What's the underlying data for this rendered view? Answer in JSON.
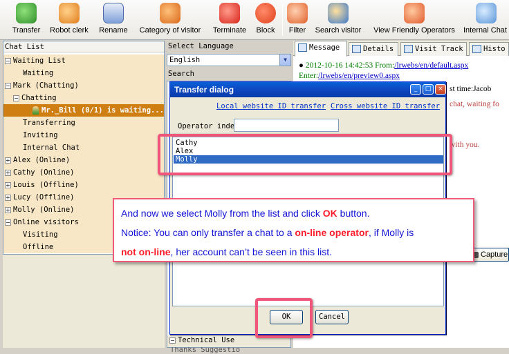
{
  "toolbar": {
    "items": [
      {
        "label": "Transfer",
        "icon": "transfer-icon"
      },
      {
        "label": "Robot clerk",
        "icon": "robot-icon"
      },
      {
        "label": "Rename",
        "icon": "rename-icon"
      },
      {
        "label": "Category of visitor",
        "icon": "category-icon"
      },
      {
        "label": "Terminate",
        "icon": "terminate-icon"
      },
      {
        "label": "Block",
        "icon": "block-icon"
      },
      {
        "label": "Filter",
        "icon": "filter-icon"
      },
      {
        "label": "Search visitor",
        "icon": "search-visitor-icon"
      },
      {
        "label": "View Friendly Operators",
        "icon": "friendly-operators-icon"
      },
      {
        "label": "Internal Chat",
        "icon": "internal-chat-icon"
      }
    ]
  },
  "chat_list": {
    "title": "Chat List",
    "items": [
      {
        "label": "Waiting List",
        "toggle": "−"
      },
      {
        "label": "Waiting"
      },
      {
        "label": "Mark (Chatting)",
        "toggle": "−"
      },
      {
        "label": "Chatting",
        "toggle": "−"
      },
      {
        "label": "Mr._Bill (0/1) is waiting..."
      },
      {
        "label": "Transferring"
      },
      {
        "label": "Inviting"
      },
      {
        "label": "Internal Chat"
      },
      {
        "label": "Alex (Online)",
        "toggle": "+"
      },
      {
        "label": "Cathy (Online)",
        "toggle": "+"
      },
      {
        "label": "Louis (Offline)",
        "toggle": "+"
      },
      {
        "label": "Lucy (Offline)",
        "toggle": "+"
      },
      {
        "label": "Molly (Online)",
        "toggle": "+"
      },
      {
        "label": "Online visitors",
        "toggle": "−"
      },
      {
        "label": "Visiting"
      },
      {
        "label": "Offline"
      }
    ]
  },
  "middle": {
    "select_language_label": "Select Language",
    "language_value": "English",
    "search_label": "Search",
    "list_items": [
      "Thanks Suggestio",
      "Technical Use"
    ]
  },
  "tabs": [
    {
      "label": "Message",
      "active": true
    },
    {
      "label": "Details"
    },
    {
      "label": "Visit Track"
    },
    {
      "label": "Histo"
    }
  ],
  "message": {
    "timestamp_line": "2012-10-16 14:42:53 From:",
    "from_link": "/lrwebs/en/default.aspx",
    "enter_label": "Enter:",
    "enter_link": "/lrwebs/en/preview0.aspx",
    "fragment_1": "st time:Jacob",
    "fragment_2": "chat, waiting fo",
    "fragment_3": "with you."
  },
  "capture_button": "Capture",
  "dialog": {
    "title": "Transfer dialog",
    "link_local": "Local website ID transfer",
    "link_cross": "Cross website ID transfer",
    "operator_index_label": "Operator index",
    "operator_index_value": "",
    "operators": [
      "Cathy",
      "Alex",
      "Molly"
    ],
    "selected_operator": "Molly",
    "ok_label": "OK",
    "cancel_label": "Cancel"
  },
  "callout": {
    "line1_a": "And now we select Molly from the list and click ",
    "line1_b": "OK",
    "line1_c": " button.",
    "line2_a": "Notice: You can only transfer a chat to a ",
    "line2_b": "on-line operator",
    "line2_c": ", if Molly is",
    "line3_a": "not on-line",
    "line3_b": ", her account can’t be seen in this list."
  },
  "colors": {
    "highlight": "#f0567a",
    "selection": "#316ac5",
    "chat_selected": "#cf7e12",
    "callout_text": "#1414d8",
    "callout_emphasis": "#ff1d2b"
  }
}
